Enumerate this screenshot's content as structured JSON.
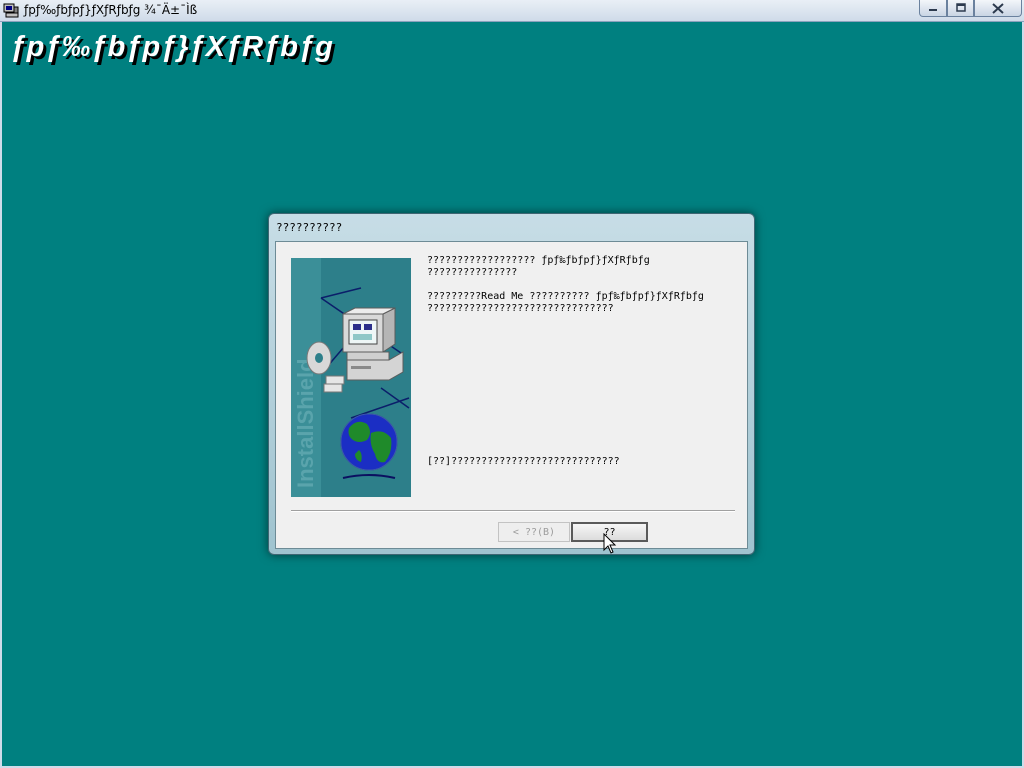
{
  "window": {
    "title": "ƒpƒ‰ƒbƒpƒ}ƒXƒRƒbƒg ¾¯Ä±¯Ìß",
    "minimize_icon": "minimize-icon",
    "maximize_icon": "maximize-icon",
    "close_icon": "close-icon"
  },
  "banner": {
    "title": "ƒpƒ‰ƒbƒpƒ}ƒXƒRƒbƒg"
  },
  "dialog": {
    "title": "??????????",
    "message1": "?????????????????? ƒpƒ‰ƒbƒpƒ}ƒXƒRƒbƒg\n???????????????",
    "message2": "?????????Read Me ?????????? ƒpƒ‰ƒbƒpƒ}ƒXƒRƒbƒg\n???????????????????????????????",
    "message3": "[??]????????????????????????????",
    "back_button": "< ??(B)",
    "next_button": "??",
    "side_image_text": "InstallShield"
  },
  "colors": {
    "desktop": "#008080",
    "dialog_frame": "#9fc3cf",
    "side_panel": "#2d7f8a"
  }
}
